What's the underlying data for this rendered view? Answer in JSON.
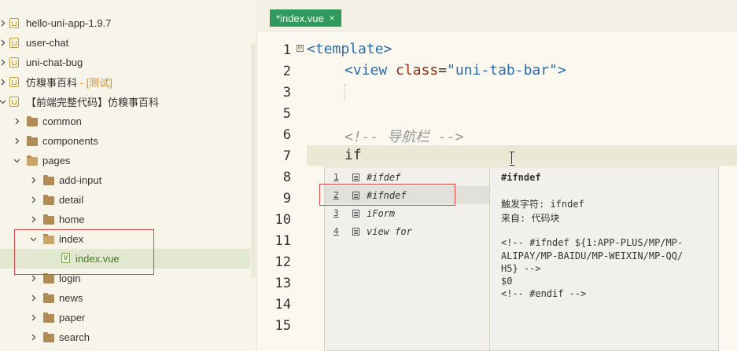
{
  "sidebar": {
    "items": [
      {
        "label": "hello-uni-app-1.9.7",
        "tag": "",
        "type": "project",
        "chevron": "right"
      },
      {
        "label": "user-chat",
        "tag": "",
        "type": "project",
        "chevron": "right"
      },
      {
        "label": "uni-chat-bug",
        "tag": "",
        "type": "project",
        "chevron": "right"
      },
      {
        "label": "仿糗事百科",
        "tag": " - [测试]",
        "type": "project",
        "chevron": "right"
      },
      {
        "label": "【前端完整代码】仿糗事百科",
        "tag": "",
        "type": "project",
        "chevron": "down"
      },
      {
        "label": "common",
        "tag": "",
        "type": "folder",
        "chevron": "right"
      },
      {
        "label": "components",
        "tag": "",
        "type": "folder",
        "chevron": "right"
      },
      {
        "label": "pages",
        "tag": "",
        "type": "folder",
        "chevron": "down"
      },
      {
        "label": "add-input",
        "tag": "",
        "type": "folder",
        "chevron": "right"
      },
      {
        "label": "detail",
        "tag": "",
        "type": "folder",
        "chevron": "right"
      },
      {
        "label": "home",
        "tag": "",
        "type": "folder",
        "chevron": "right"
      },
      {
        "label": "index",
        "tag": "",
        "type": "folder",
        "chevron": "down"
      },
      {
        "label": "index.vue",
        "tag": "",
        "type": "file",
        "chevron": "none"
      },
      {
        "label": "login",
        "tag": "",
        "type": "folder",
        "chevron": "right"
      },
      {
        "label": "news",
        "tag": "",
        "type": "folder",
        "chevron": "right"
      },
      {
        "label": "paper",
        "tag": "",
        "type": "folder",
        "chevron": "right"
      },
      {
        "label": "search",
        "tag": "",
        "type": "folder",
        "chevron": "right"
      }
    ]
  },
  "tab": {
    "label": "*index.vue",
    "close": "×"
  },
  "editor": {
    "line_numbers": [
      "1",
      "2",
      "3",
      "5",
      "6",
      "7",
      "8",
      "9",
      "10",
      "11",
      "12",
      "13",
      "14",
      "15"
    ],
    "lines": {
      "l1_tag": "<template>",
      "l2_open": "<view ",
      "l2_attr": "class",
      "l2_eq": "=",
      "l2_val": "\"uni-tab-bar\"",
      "l2_close": ">",
      "l5_comment": "<!-- 导航栏 -->",
      "l6_text": "if"
    },
    "fold_marker": "⊟"
  },
  "autocomplete": {
    "items": [
      {
        "index": "1",
        "label": "#ifdef"
      },
      {
        "index": "2",
        "label": "#ifndef"
      },
      {
        "index": "3",
        "label": "iForm"
      },
      {
        "index": "4",
        "label": "view for"
      }
    ],
    "selected_index": 1,
    "detail": {
      "title": "#ifndef",
      "trigger": "触发字符: ifndef",
      "source": "来自: 代码块",
      "snippet_1": "<!-- #ifndef ${1:APP-PLUS/MP/MP-",
      "snippet_2": "ALIPAY/MP-BAIDU/MP-WEIXIN/MP-QQ/",
      "snippet_3": "H5} -->",
      "snippet_4": "$0",
      "snippet_5": "<!-- #endif -->"
    }
  },
  "colors": {
    "tab_active": "#2f9a5b",
    "highlight_box": "#e04545",
    "selected_row": "#e2e8d0"
  }
}
